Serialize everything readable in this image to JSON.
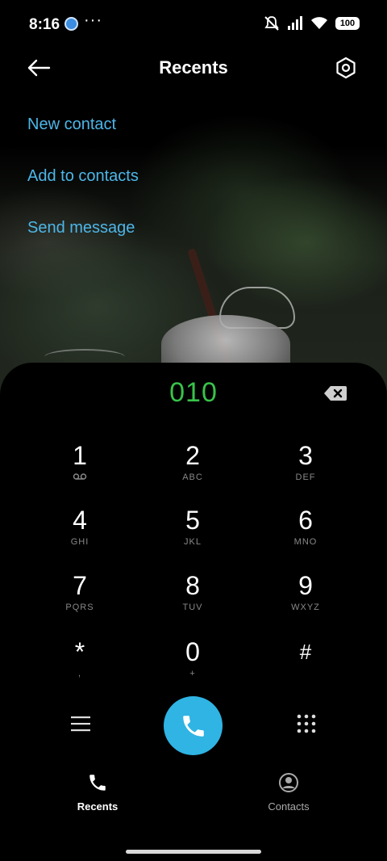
{
  "status_bar": {
    "time": "8:16",
    "more": "···",
    "battery": "100"
  },
  "header": {
    "title": "Recents"
  },
  "actions": {
    "new_contact": "New contact",
    "add_to_contacts": "Add to contacts",
    "send_message": "Send message"
  },
  "dialer": {
    "number": "010",
    "keys": [
      {
        "digit": "1",
        "letters": ""
      },
      {
        "digit": "2",
        "letters": "ABC"
      },
      {
        "digit": "3",
        "letters": "DEF"
      },
      {
        "digit": "4",
        "letters": "GHI"
      },
      {
        "digit": "5",
        "letters": "JKL"
      },
      {
        "digit": "6",
        "letters": "MNO"
      },
      {
        "digit": "7",
        "letters": "PQRS"
      },
      {
        "digit": "8",
        "letters": "TUV"
      },
      {
        "digit": "9",
        "letters": "WXYZ"
      },
      {
        "digit": "*",
        "letters": ","
      },
      {
        "digit": "0",
        "letters": "+"
      },
      {
        "digit": "#",
        "letters": ""
      }
    ]
  },
  "tabs": {
    "recents": "Recents",
    "contacts": "Contacts"
  },
  "colors": {
    "accent": "#4db6e8",
    "call_button": "#2fb4e4",
    "dialed_number": "#39c24a"
  },
  "icons": {
    "back": "arrow-left-icon",
    "settings": "settings-hex-icon",
    "backspace": "backspace-icon",
    "voicemail": "voicemail-icon",
    "menu": "menu-icon",
    "call": "phone-icon",
    "dialpad": "dialpad-icon",
    "recents_tab": "phone-icon",
    "contacts_tab": "person-circle-icon"
  }
}
